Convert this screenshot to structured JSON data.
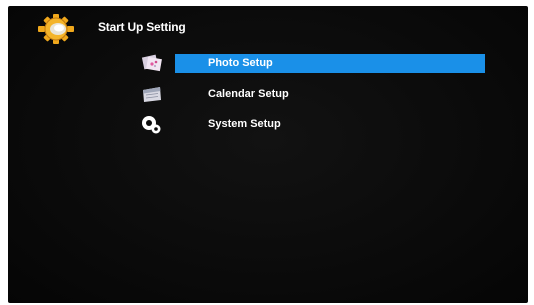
{
  "header": {
    "title": "Start Up Setting",
    "icon": "gear-icon"
  },
  "menu": {
    "items": [
      {
        "label": "Photo Setup",
        "icon": "photo-icon",
        "selected": true
      },
      {
        "label": "Calendar Setup",
        "icon": "calendar-icon",
        "selected": false
      },
      {
        "label": "System Setup",
        "icon": "system-gears-icon",
        "selected": false
      }
    ]
  },
  "colors": {
    "background": "#0b0b0b",
    "highlight": "#1a90e8",
    "text": "#ffffff",
    "gear": "#f0a81c"
  }
}
